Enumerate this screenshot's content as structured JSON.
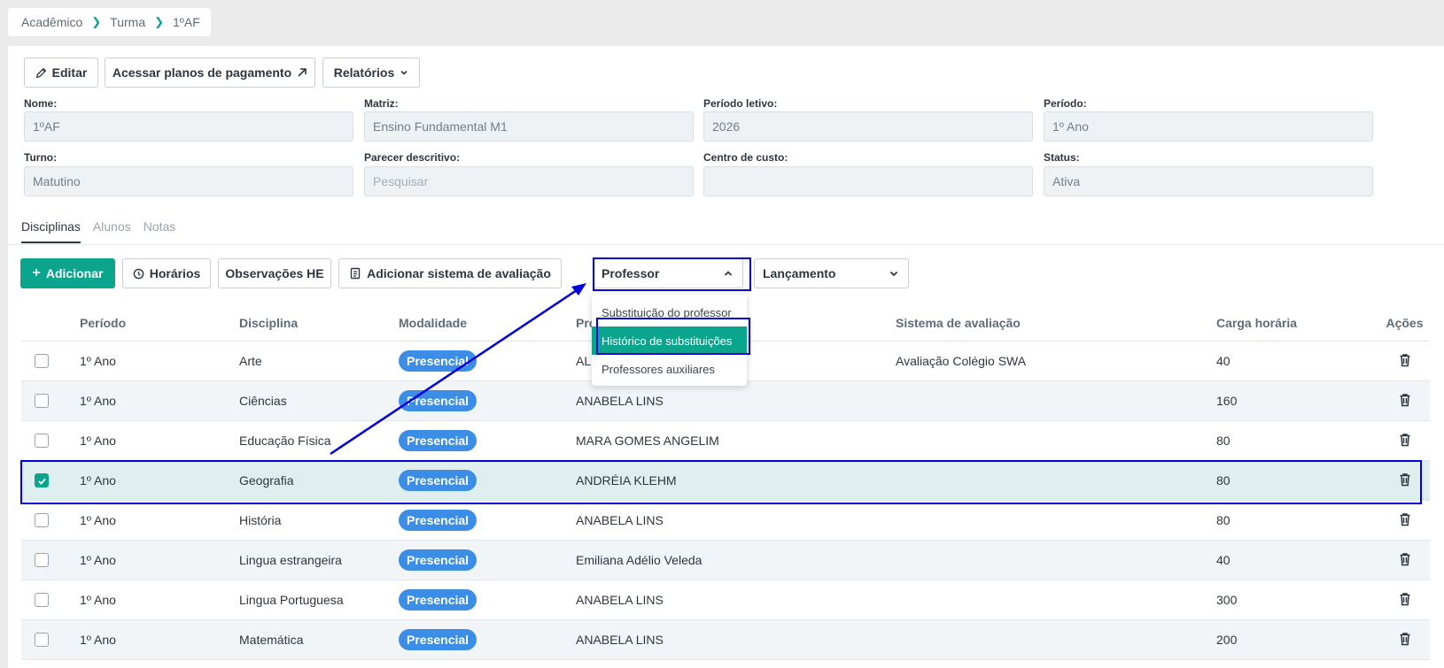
{
  "breadcrumb": {
    "items": [
      "Acadêmico",
      "Turma",
      "1ºAF"
    ]
  },
  "toolbar": {
    "edit_label": "Editar",
    "payment_plans_label": "Acessar planos de pagamento",
    "reports_label": "Relatórios"
  },
  "fields": {
    "nome": {
      "label": "Nome:",
      "value": "1ºAF"
    },
    "matriz": {
      "label": "Matriz:",
      "value": "Ensino Fundamental M1"
    },
    "periodo_letivo": {
      "label": "Período letivo:",
      "value": "2026"
    },
    "periodo": {
      "label": "Período:",
      "value": "1º Ano"
    },
    "turno": {
      "label": "Turno:",
      "value": "Matutino"
    },
    "parecer": {
      "label": "Parecer descritivo:",
      "placeholder": "Pesquisar"
    },
    "centro_custo": {
      "label": "Centro de custo:",
      "value": ""
    },
    "status": {
      "label": "Status:",
      "value": "Ativa"
    }
  },
  "tabs": [
    "Disciplinas",
    "Alunos",
    "Notas"
  ],
  "actions": {
    "add_label": "Adicionar",
    "schedules_label": "Horários",
    "notes_he_label": "Observações HE",
    "add_eval_label": "Adicionar sistema de avaliação",
    "professor_select": "Professor",
    "lancamento_select": "Lançamento"
  },
  "professor_menu": [
    "Substituição do professor",
    "Histórico de substituições",
    "Professores auxiliares"
  ],
  "table": {
    "headers": [
      "Período",
      "Disciplina",
      "Modalidade",
      "Professor",
      "Sistema de avaliação",
      "Carga horária",
      "Ações"
    ],
    "rows": [
      {
        "periodo": "1º Ano",
        "disciplina": "Arte",
        "modalidade": "Presencial",
        "professor": "AL",
        "sistema": "Avaliação Colégio SWA",
        "carga": "40",
        "checked": false
      },
      {
        "periodo": "1º Ano",
        "disciplina": "Ciências",
        "modalidade": "Presencial",
        "professor": "ANABELA LINS",
        "sistema": "",
        "carga": "160",
        "checked": false
      },
      {
        "periodo": "1º Ano",
        "disciplina": "Educação Física",
        "modalidade": "Presencial",
        "professor": "MARA GOMES ANGELIM",
        "sistema": "",
        "carga": "80",
        "checked": false
      },
      {
        "periodo": "1º Ano",
        "disciplina": "Geografia",
        "modalidade": "Presencial",
        "professor": "ANDRÉIA KLEHM",
        "sistema": "",
        "carga": "80",
        "checked": true
      },
      {
        "periodo": "1º Ano",
        "disciplina": "História",
        "modalidade": "Presencial",
        "professor": "ANABELA LINS",
        "sistema": "",
        "carga": "80",
        "checked": false
      },
      {
        "periodo": "1º Ano",
        "disciplina": "Lingua estrangeira",
        "modalidade": "Presencial",
        "professor": "Emiliana Adélio Veleda",
        "sistema": "",
        "carga": "40",
        "checked": false
      },
      {
        "periodo": "1º Ano",
        "disciplina": "Lingua Portuguesa",
        "modalidade": "Presencial",
        "professor": "ANABELA LINS",
        "sistema": "",
        "carga": "300",
        "checked": false
      },
      {
        "periodo": "1º Ano",
        "disciplina": "Matemática",
        "modalidade": "Presencial",
        "professor": "ANABELA LINS",
        "sistema": "",
        "carga": "200",
        "checked": false
      }
    ]
  },
  "colors": {
    "accent": "#0aa58c",
    "badge": "#3b8de6",
    "highlight": "#0000dd"
  }
}
